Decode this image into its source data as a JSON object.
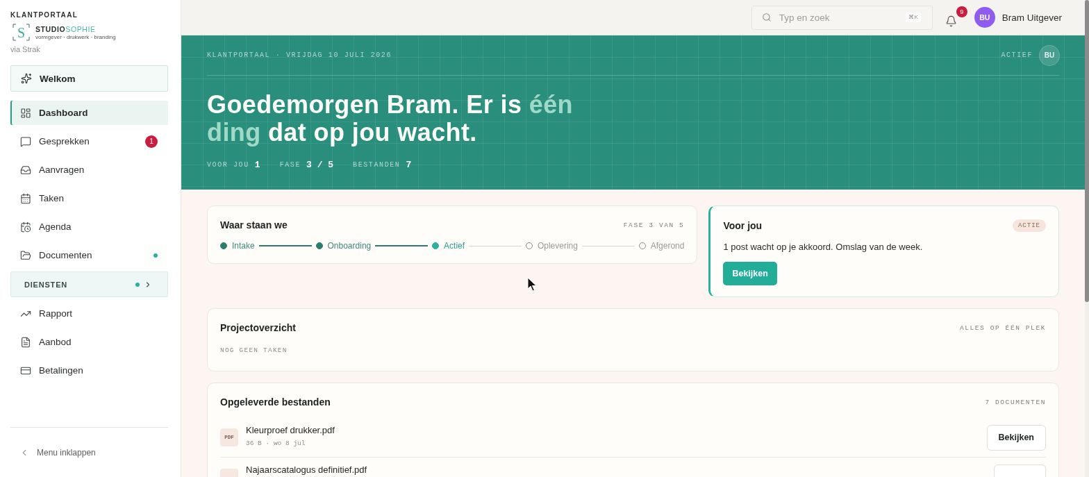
{
  "sidebar": {
    "eyebrow": "KLANTPORTAAL",
    "logo": {
      "mark": "S",
      "name_first": "STUDIO",
      "name_second": "SOPHIE",
      "tagline": "vormgever · drukwerk · branding"
    },
    "via": "via Strak",
    "welcome": {
      "label": "Welkom"
    },
    "items": [
      {
        "kind": "link",
        "label": "Dashboard",
        "selected": true,
        "dot": false
      },
      {
        "kind": "link",
        "label": "Gesprekken",
        "selected": false,
        "dot": false,
        "badge": "1"
      },
      {
        "kind": "link",
        "label": "Aanvragen",
        "selected": false,
        "dot": false
      },
      {
        "kind": "link",
        "label": "Taken",
        "selected": false,
        "dot": false
      },
      {
        "kind": "link",
        "label": "Agenda",
        "selected": false,
        "dot": false
      },
      {
        "kind": "link",
        "label": "Documenten",
        "selected": false,
        "dot": true
      },
      {
        "kind": "section",
        "label": "DIENSTEN",
        "selected": false,
        "dot": true,
        "expanded": false
      },
      {
        "kind": "link",
        "label": "Rapport",
        "selected": false,
        "dot": false
      },
      {
        "kind": "link",
        "label": "Aanbod",
        "selected": false,
        "dot": false
      },
      {
        "kind": "link",
        "label": "Betalingen",
        "selected": false,
        "dot": false
      }
    ],
    "collapse": {
      "label": "Menu inklappen"
    }
  },
  "topbar": {
    "search": {
      "placeholder": "Typ en zoek",
      "shortcut": "⌘K"
    },
    "notifications": {
      "count": "9"
    },
    "user": {
      "initials": "BU",
      "name": "Bram Uitgever"
    }
  },
  "hero": {
    "eyebrow": "KLANTPORTAAL · VRIJDAG 10 JULI 2026",
    "status": "ACTIEF",
    "initials": "BU",
    "greeting": {
      "before": "Goedemorgen Bram. Er is ",
      "highlight": "één ding",
      "after": " dat op jou wacht."
    },
    "stats": [
      {
        "label": "VOOR JOU",
        "value": "1"
      },
      {
        "label": "FASE",
        "value": "3 / 5"
      },
      {
        "label": "BESTANDEN",
        "value": "7"
      }
    ]
  },
  "progress": {
    "title": "Waar staan we",
    "phase": "FASE 3 VAN 5",
    "steps": [
      {
        "label": "Intake",
        "completed": true,
        "active": false
      },
      {
        "label": "Onboarding",
        "completed": true,
        "active": false
      },
      {
        "label": "Actief",
        "completed": false,
        "active": true
      },
      {
        "label": "Oplevering",
        "completed": false,
        "active": false
      },
      {
        "label": "Afgerond",
        "completed": false,
        "active": false
      }
    ]
  },
  "for_you": {
    "title": "Voor jou",
    "badge": "ACTIE",
    "message": "1 post wacht op je akkoord. Omslag van de week.",
    "button": "Bekijken"
  },
  "overview": {
    "title": "Projectoverzicht",
    "note": "ALLES OP ÉÉN PLEK",
    "empty": "NOG GEEN TAKEN"
  },
  "files": {
    "title": "Opgeleverde bestanden",
    "count": "7 DOCUMENTEN",
    "rows": [
      {
        "type": "PDF",
        "name": "Kleurproef drukker.pdf",
        "meta": "36 B · wo 8 jul",
        "action": "Bekijken"
      },
      {
        "name": "Najaarscatalogus definitief.pdf"
      }
    ]
  }
}
